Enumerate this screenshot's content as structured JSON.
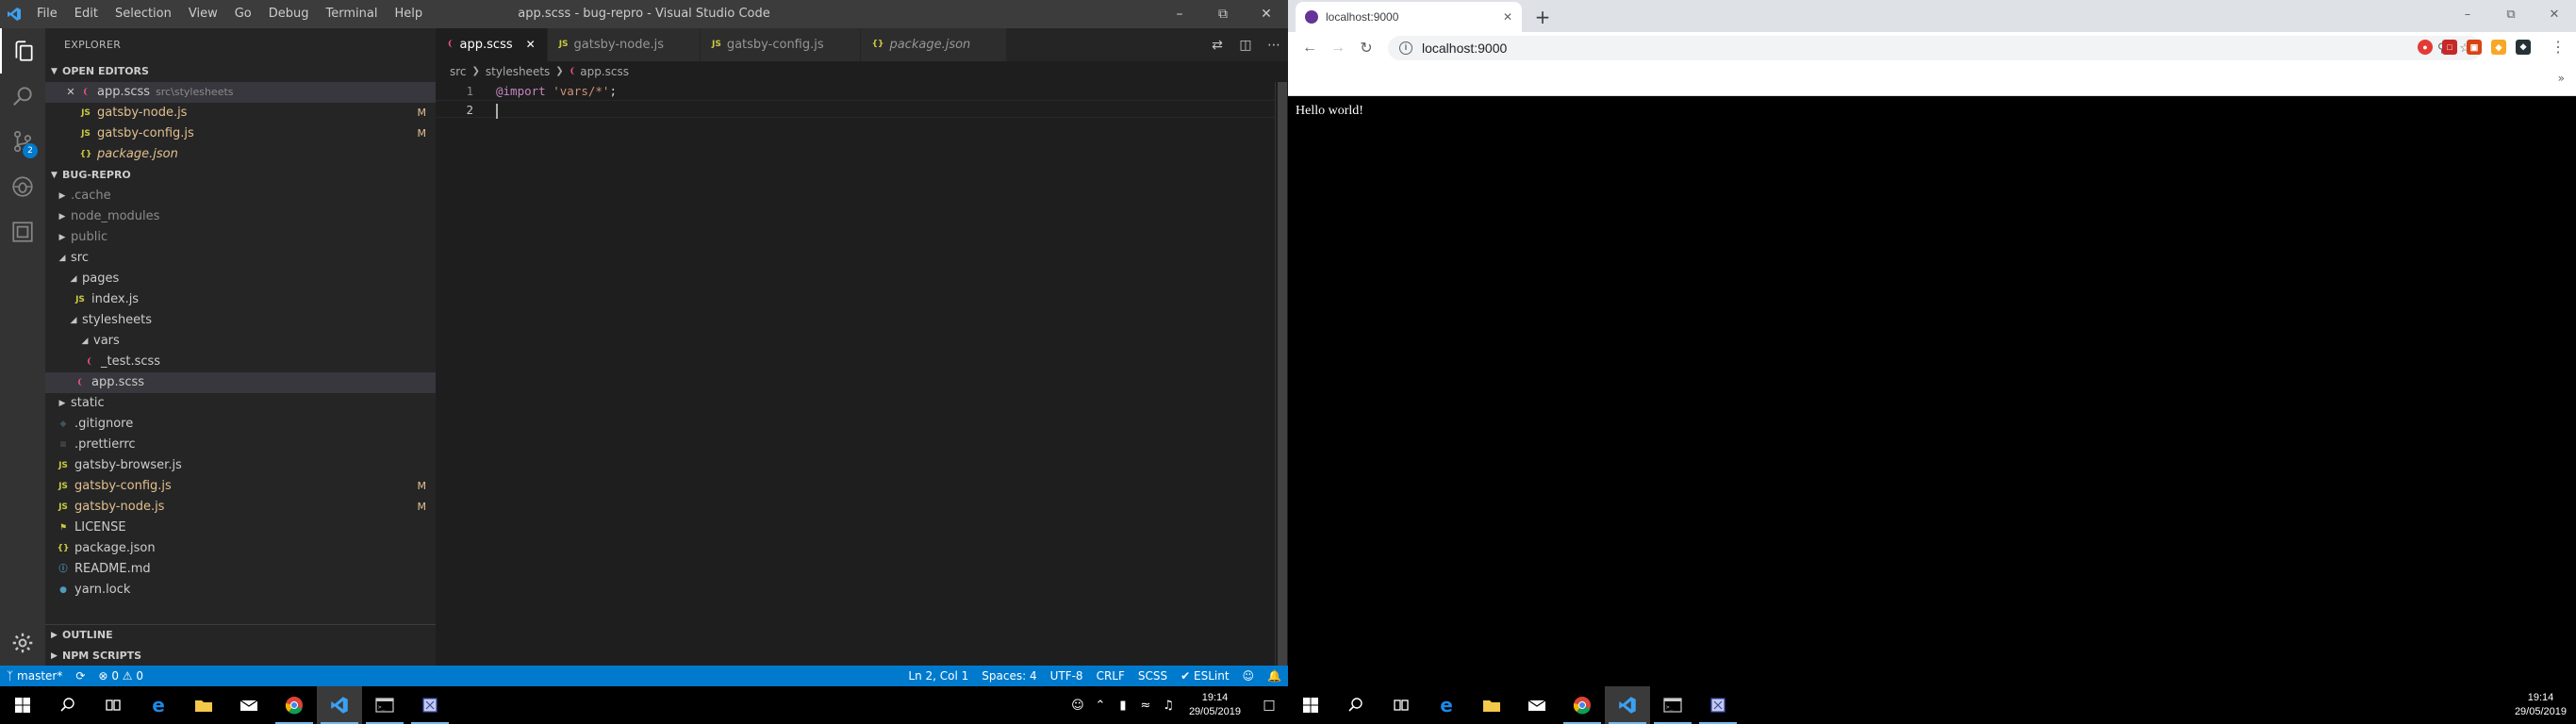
{
  "vscode": {
    "title": "app.scss - bug-repro - Visual Studio Code",
    "menu": [
      "File",
      "Edit",
      "Selection",
      "View",
      "Go",
      "Debug",
      "Terminal",
      "Help"
    ],
    "activity_badge": "2",
    "sidebar": {
      "title": "EXPLORER",
      "open_editors_header": "OPEN EDITORS",
      "open_editors": [
        {
          "name": "app.scss",
          "desc": "src\\stylesheets",
          "type": "scss"
        },
        {
          "name": "gatsby-node.js",
          "flag": "M",
          "type": "js"
        },
        {
          "name": "gatsby-config.js",
          "flag": "M",
          "type": "js"
        },
        {
          "name": "package.json",
          "type": "json"
        }
      ],
      "project_header": "BUG-REPRO",
      "tree": [
        {
          "name": ".cache"
        },
        {
          "name": "node_modules"
        },
        {
          "name": "public"
        },
        {
          "name": "src"
        },
        {
          "name": "pages"
        },
        {
          "name": "index.js"
        },
        {
          "name": "stylesheets"
        },
        {
          "name": "vars"
        },
        {
          "name": "_test.scss"
        },
        {
          "name": "app.scss"
        },
        {
          "name": "static"
        },
        {
          "name": ".gitignore"
        },
        {
          "name": ".prettierrc"
        },
        {
          "name": "gatsby-browser.js"
        },
        {
          "name": "gatsby-config.js",
          "flag": "M"
        },
        {
          "name": "gatsby-node.js",
          "flag": "M"
        },
        {
          "name": "LICENSE"
        },
        {
          "name": "package.json"
        },
        {
          "name": "README.md"
        },
        {
          "name": "yarn.lock"
        }
      ],
      "outline_header": "OUTLINE",
      "npm_header": "NPM SCRIPTS"
    },
    "tabs": [
      {
        "label": "app.scss"
      },
      {
        "label": "gatsby-node.js"
      },
      {
        "label": "gatsby-config.js"
      },
      {
        "label": "package.json"
      }
    ],
    "breadcrumb": [
      "src",
      "stylesheets",
      "app.scss"
    ],
    "code": {
      "line1_num": "1",
      "line2_num": "2",
      "line1_keyword": "@import",
      "line1_string": "'vars/*'",
      "line1_end": ";"
    },
    "status": {
      "branch": "master*",
      "errors": "0",
      "warnings": "0",
      "position": "Ln 2, Col 1",
      "spaces": "Spaces: 4",
      "encoding": "UTF-8",
      "eol": "CRLF",
      "language": "SCSS",
      "linter": "ESLint"
    }
  },
  "chrome": {
    "tab_title": "localhost:9000",
    "url": "localhost:9000",
    "page_text": "Hello world!"
  },
  "taskbar": {
    "time": "19:14",
    "date": "29/05/2019"
  },
  "colors": {
    "statusbar": "#007acc",
    "activitybar": "#333333",
    "sidebar": "#252526",
    "editor": "#1e1e1e"
  }
}
